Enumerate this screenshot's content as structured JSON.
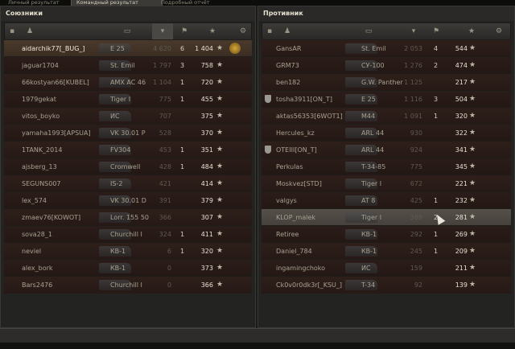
{
  "tabs": [
    "Личный результат",
    "Командный результат",
    "Подробный отчёт"
  ],
  "left": {
    "title": "Союзники",
    "rows": [
      {
        "name": "aidarchik77[_BUG_]",
        "tank": "E 25",
        "dmg": "4 620",
        "kills": "6",
        "xp": "1 404",
        "me": true,
        "medal": true
      },
      {
        "name": "jaguar1704",
        "tank": "St. Emil",
        "dmg": "1 797",
        "kills": "3",
        "xp": "758"
      },
      {
        "name": "66kostyan66[KUBEL]",
        "tank": "AMX AC 46",
        "dmg": "1 104",
        "kills": "1",
        "xp": "720"
      },
      {
        "name": "1979gekat",
        "tank": "Tiger I",
        "dmg": "775",
        "kills": "1",
        "xp": "455"
      },
      {
        "name": "vitos_boyko",
        "tank": "ИС",
        "dmg": "707",
        "kills": "",
        "xp": "375"
      },
      {
        "name": "yamaha1993[APSUA]",
        "tank": "VK 30.01 P",
        "dmg": "528",
        "kills": "",
        "xp": "370"
      },
      {
        "name": "1TANK_2014",
        "tank": "FV304",
        "dmg": "453",
        "kills": "1",
        "xp": "351"
      },
      {
        "name": "ajsberg_13",
        "tank": "Cromwell",
        "dmg": "428",
        "kills": "1",
        "xp": "484"
      },
      {
        "name": "SEGUNS007",
        "tank": "IS-2",
        "dmg": "421",
        "kills": "",
        "xp": "414"
      },
      {
        "name": "lex_574",
        "tank": "VK 30.01 D",
        "dmg": "391",
        "kills": "",
        "xp": "379"
      },
      {
        "name": "zmaev76[KOWOT]",
        "tank": "Lorr. 155 50",
        "dmg": "366",
        "kills": "",
        "xp": "307"
      },
      {
        "name": "sova28_1",
        "tank": "Churchill I",
        "dmg": "324",
        "kills": "1",
        "xp": "411"
      },
      {
        "name": "neviel",
        "tank": "КВ-1",
        "dmg": "6",
        "kills": "1",
        "xp": "320"
      },
      {
        "name": "alex_bork",
        "tank": "КВ-1",
        "dmg": "0",
        "kills": "",
        "xp": "373"
      },
      {
        "name": "Bars2476",
        "tank": "Churchill I",
        "dmg": "0",
        "kills": "",
        "xp": "366"
      }
    ]
  },
  "right": {
    "title": "Противник",
    "rows": [
      {
        "name": "GansAR",
        "tank": "St. Emil",
        "dmg": "2 053",
        "kills": "4",
        "xp": "544"
      },
      {
        "name": "GRM73",
        "tank": "СУ-100",
        "dmg": "1 276",
        "kills": "2",
        "xp": "474"
      },
      {
        "name": "ben182",
        "tank": "G.W. Panther",
        "dmg": "1 125",
        "kills": "",
        "xp": "217"
      },
      {
        "name": "tosha3911[ON_T]",
        "tank": "E 25",
        "dmg": "1 116",
        "kills": "3",
        "xp": "504",
        "shield": true
      },
      {
        "name": "aktas56353[6WOT1]",
        "tank": "M44",
        "dmg": "1 091",
        "kills": "1",
        "xp": "320"
      },
      {
        "name": "Hercules_kz",
        "tank": "ARL 44",
        "dmg": "930",
        "kills": "",
        "xp": "322"
      },
      {
        "name": "OTEIII[ON_T]",
        "tank": "ARL 44",
        "dmg": "924",
        "kills": "",
        "xp": "341",
        "shield": true
      },
      {
        "name": "Perkulas",
        "tank": "T-34-85",
        "dmg": "775",
        "kills": "",
        "xp": "345"
      },
      {
        "name": "Moskvez[STD]",
        "tank": "Tiger I",
        "dmg": "672",
        "kills": "",
        "xp": "221"
      },
      {
        "name": "valgys",
        "tank": "AT 8",
        "dmg": "425",
        "kills": "1",
        "xp": "232"
      },
      {
        "name": "KLOP_malek",
        "tank": "Tiger I",
        "dmg": "389",
        "kills": "2",
        "xp": "281",
        "hl": true
      },
      {
        "name": "Retiree",
        "tank": "КВ-1",
        "dmg": "292",
        "kills": "1",
        "xp": "269"
      },
      {
        "name": "Daniel_784",
        "tank": "КВ-1",
        "dmg": "245",
        "kills": "1",
        "xp": "209"
      },
      {
        "name": "ingamingchoko",
        "tank": "ИС",
        "dmg": "159",
        "kills": "",
        "xp": "211"
      },
      {
        "name": "Ck0v0r0dk3r[_KSU_]",
        "tank": "T-34",
        "dmg": "92",
        "kills": "",
        "xp": "139"
      }
    ]
  },
  "icons": {
    "star": "★",
    "vehicle": "tank-icon",
    "person": "player-icon",
    "medal": "medal-icon",
    "clan": "clan-shield-icon"
  },
  "colors": {
    "row": "#2e1f1a",
    "highlight": "#4a3a2c",
    "accent": "#d4a93c"
  }
}
